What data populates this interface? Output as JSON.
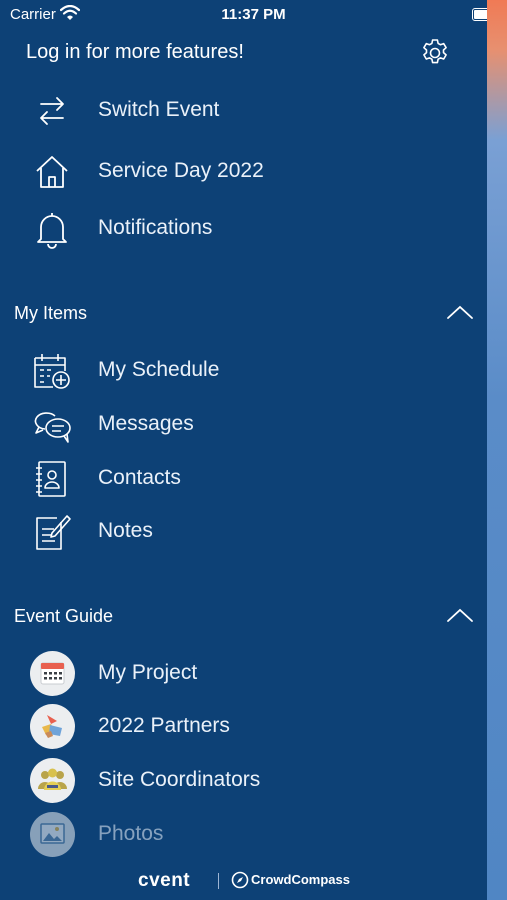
{
  "status_bar": {
    "carrier": "Carrier",
    "time": "11:37 PM"
  },
  "header": {
    "login_prompt": "Log in for more features!"
  },
  "top_items": [
    {
      "label": "Switch Event",
      "icon": "switch-arrows-icon"
    },
    {
      "label": "Service Day 2022",
      "icon": "home-icon"
    },
    {
      "label": "Notifications",
      "icon": "bell-icon"
    }
  ],
  "my_items": {
    "title": "My Items",
    "items": [
      {
        "label": "My Schedule",
        "icon": "calendar-add-icon"
      },
      {
        "label": "Messages",
        "icon": "chat-bubbles-icon"
      },
      {
        "label": "Contacts",
        "icon": "contact-book-icon"
      },
      {
        "label": "Notes",
        "icon": "notes-pencil-icon"
      }
    ]
  },
  "event_guide": {
    "title": "Event Guide",
    "items": [
      {
        "label": "My Project",
        "icon": "calendar-grid-icon"
      },
      {
        "label": "2022 Partners",
        "icon": "partners-icon"
      },
      {
        "label": "Site Coordinators",
        "icon": "people-group-icon"
      },
      {
        "label": "Photos",
        "icon": "photo-icon"
      }
    ]
  },
  "footer": {
    "brand": "cvent",
    "product": "CrowdCompass"
  },
  "colors": {
    "background": "#0d4176",
    "text": "#ffffff",
    "accent_red": "#e8604f"
  }
}
